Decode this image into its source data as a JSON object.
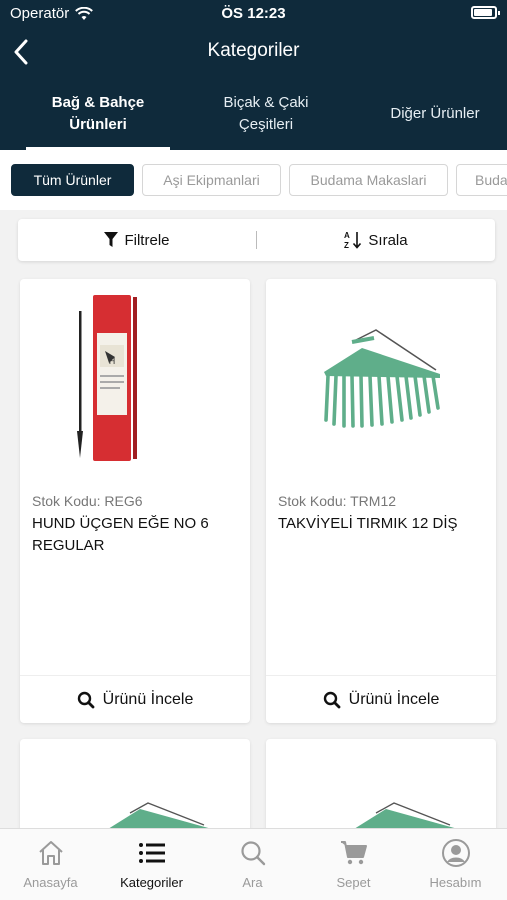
{
  "status_bar": {
    "carrier": "Operatör",
    "time": "ÖS 12:23"
  },
  "nav": {
    "title": "Kategoriler"
  },
  "top_tabs": [
    {
      "line1": "Bağ & Bahçe",
      "line2": "Ürünleri"
    },
    {
      "line1": "Biçak & Çaki",
      "line2": "Çeşitleri"
    },
    {
      "line1": "Diğer Ürünler",
      "line2": ""
    }
  ],
  "chips": [
    "Tüm Ürünler",
    "Aşi Ekipmanlari",
    "Budama Makaslari",
    "Buda"
  ],
  "toolbar": {
    "filter_label": "Filtrele",
    "sort_label": "Sırala"
  },
  "products": [
    {
      "stock": "Stok Kodu: REG6",
      "name": "HUND ÜÇGEN EĞE NO 6 REGULAR",
      "action": "Ürünü İncele"
    },
    {
      "stock": "Stok Kodu: TRM12",
      "name": "TAKVİYELİ TIRMIK 12 DİŞ",
      "action": "Ürünü İncele"
    }
  ],
  "bottom_nav": [
    "Anasayfa",
    "Kategoriler",
    "Ara",
    "Sepet",
    "Hesabım"
  ],
  "colors": {
    "brand": "#0f2a3b",
    "rake_green": "#5fae8a"
  }
}
